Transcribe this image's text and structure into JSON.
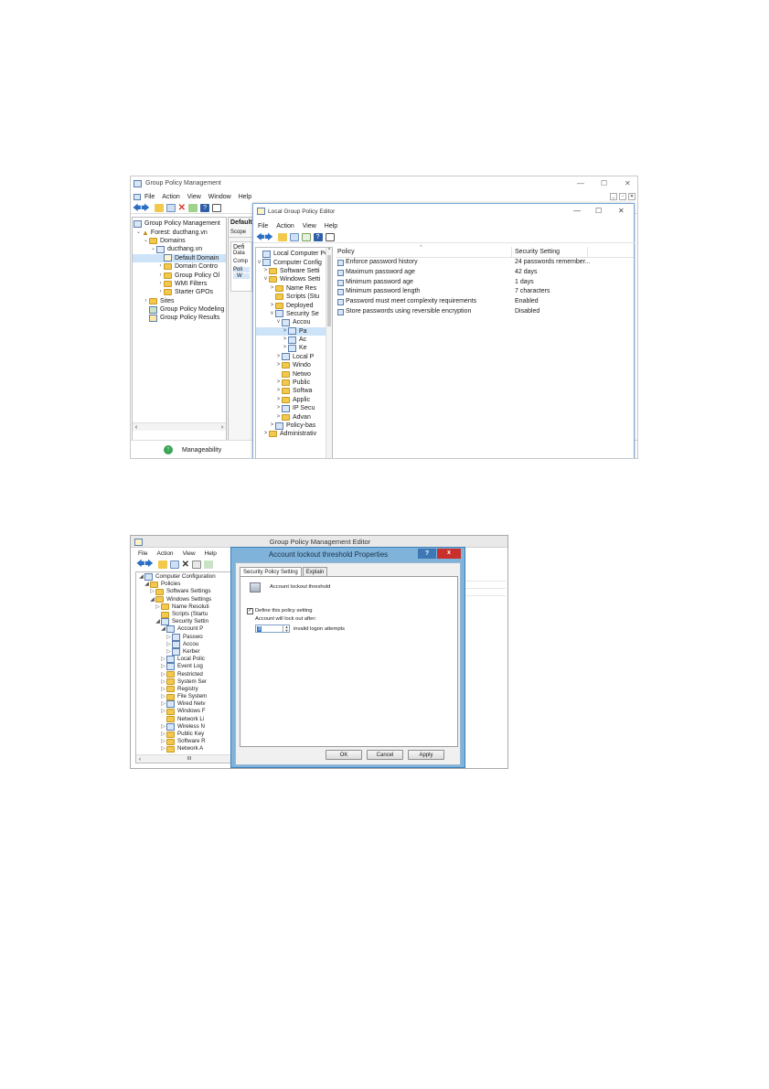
{
  "gpm": {
    "title": "Group Policy Management",
    "menu": [
      "File",
      "Action",
      "View",
      "Window",
      "Help"
    ],
    "tree": {
      "root": "Group Policy Management",
      "forest": "Forest: ducthang.vn",
      "domains": "Domains",
      "domain": "ducthang.vn",
      "children": [
        "Default Domain",
        "Domain Contro",
        "Group Policy Ol",
        "WMI Filters",
        "Starter GPOs"
      ],
      "sites": "Sites",
      "modeling": "Group Policy Modeling",
      "results": "Group Policy Results"
    },
    "right_labels": {
      "header": "Default",
      "scope": "Scope",
      "defi": "Defi",
      "data": "Data",
      "comp": "Comp",
      "pol": "Poli",
      "w": "W"
    },
    "status": "Manageability"
  },
  "lgpe": {
    "title": "Local Group Policy Editor",
    "menu": [
      "File",
      "Action",
      "View",
      "Help"
    ],
    "tree": [
      {
        "label": "Local Computer Polic",
        "level": 0,
        "arrow": ""
      },
      {
        "label": "Computer Config",
        "level": 0,
        "arrow": "v"
      },
      {
        "label": "Software Setti",
        "level": 1,
        "arrow": ">"
      },
      {
        "label": "Windows Setti",
        "level": 1,
        "arrow": "v"
      },
      {
        "label": "Name Res",
        "level": 2,
        "arrow": ">"
      },
      {
        "label": "Scripts (Stu",
        "level": 2,
        "arrow": ""
      },
      {
        "label": "Deployed",
        "level": 2,
        "arrow": ">"
      },
      {
        "label": "Security Se",
        "level": 2,
        "arrow": "v"
      },
      {
        "label": "Accou",
        "level": 3,
        "arrow": "v"
      },
      {
        "label": "Pa",
        "level": 4,
        "arrow": ">"
      },
      {
        "label": "Ac",
        "level": 4,
        "arrow": ">"
      },
      {
        "label": "Ke",
        "level": 4,
        "arrow": ">"
      },
      {
        "label": "Local P",
        "level": 3,
        "arrow": ">"
      },
      {
        "label": "Windo",
        "level": 3,
        "arrow": ">"
      },
      {
        "label": "Netwo",
        "level": 3,
        "arrow": ""
      },
      {
        "label": "Public",
        "level": 3,
        "arrow": ">"
      },
      {
        "label": "Softwa",
        "level": 3,
        "arrow": ">"
      },
      {
        "label": "Applic",
        "level": 3,
        "arrow": ">"
      },
      {
        "label": "IP Secu",
        "level": 3,
        "arrow": ">"
      },
      {
        "label": "Advan",
        "level": 3,
        "arrow": ">"
      },
      {
        "label": "Policy-bas",
        "level": 2,
        "arrow": ">"
      },
      {
        "label": "Administrativ",
        "level": 1,
        "arrow": ">"
      }
    ],
    "columns": {
      "policy": "Policy",
      "setting": "Security Setting"
    },
    "rows": [
      {
        "policy": "Enforce password history",
        "setting": "24 passwords remember..."
      },
      {
        "policy": "Maximum password age",
        "setting": "42 days"
      },
      {
        "policy": "Minimum password age",
        "setting": "1 days"
      },
      {
        "policy": "Minimum password length",
        "setting": "7 characters"
      },
      {
        "policy": "Password must meet complexity requirements",
        "setting": "Enabled"
      },
      {
        "policy": "Store passwords using reversible encryption",
        "setting": "Disabled"
      }
    ]
  },
  "gpme": {
    "title": "Group Policy Management Editor",
    "menu": [
      "File",
      "Action",
      "View",
      "Help"
    ],
    "tree": [
      {
        "label": "Computer Configuration",
        "level": 0,
        "arrow": "◢"
      },
      {
        "label": "Policies",
        "level": 1,
        "arrow": "◢"
      },
      {
        "label": "Software Settings",
        "level": 2,
        "arrow": "▷"
      },
      {
        "label": "Windows Settings",
        "level": 2,
        "arrow": "◢"
      },
      {
        "label": "Name Resoluti",
        "level": 3,
        "arrow": "▷"
      },
      {
        "label": "Scripts (Startu",
        "level": 3,
        "arrow": ""
      },
      {
        "label": "Security Settin",
        "level": 3,
        "arrow": "◢"
      },
      {
        "label": "Account P",
        "level": 4,
        "arrow": "◢"
      },
      {
        "label": "Passwo",
        "level": 5,
        "arrow": "▷"
      },
      {
        "label": "Accou",
        "level": 5,
        "arrow": "▷"
      },
      {
        "label": "Kerber",
        "level": 5,
        "arrow": "▷"
      },
      {
        "label": "Local Polic",
        "level": 4,
        "arrow": "▷"
      },
      {
        "label": "Event Log",
        "level": 4,
        "arrow": "▷"
      },
      {
        "label": "Restricted",
        "level": 4,
        "arrow": "▷"
      },
      {
        "label": "System Ser",
        "level": 4,
        "arrow": "▷"
      },
      {
        "label": "Registry",
        "level": 4,
        "arrow": "▷"
      },
      {
        "label": "File System",
        "level": 4,
        "arrow": "▷"
      },
      {
        "label": "Wired Netv",
        "level": 4,
        "arrow": "▷"
      },
      {
        "label": "Windows F",
        "level": 4,
        "arrow": "▷"
      },
      {
        "label": "Network Li",
        "level": 4,
        "arrow": ""
      },
      {
        "label": "Wireless N",
        "level": 4,
        "arrow": "▷"
      },
      {
        "label": "Public Key",
        "level": 4,
        "arrow": "▷"
      },
      {
        "label": "Software R",
        "level": 4,
        "arrow": "▷"
      },
      {
        "label": "Network A",
        "level": 4,
        "arrow": "▷"
      }
    ],
    "tree_scroll_label": "III"
  },
  "props": {
    "title": "Account lockout threshold Properties",
    "help_btn": "?",
    "close_btn": "x",
    "tabs": [
      "Security Policy Setting",
      "Explain"
    ],
    "policy_name": "Account lockout threshold",
    "define_label": "Define this policy setting",
    "define_checked": true,
    "lockout_label": "Account will lock out after:",
    "lockout_value": "3",
    "attempts_label": "invalid logon attempts",
    "buttons": {
      "ok": "OK",
      "cancel": "Cancel",
      "apply": "Apply"
    }
  }
}
